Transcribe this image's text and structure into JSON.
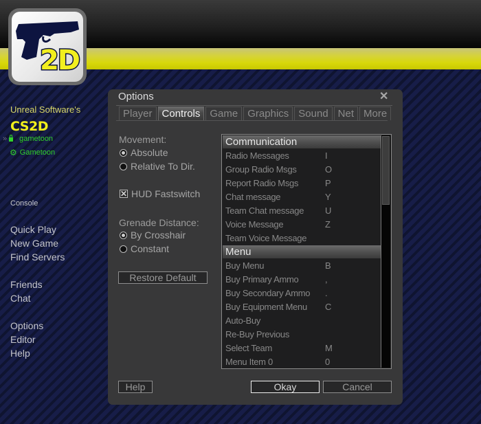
{
  "brand": {
    "logo_text": "2D",
    "publisher": "Unreal Software's",
    "game_title": "CS2D"
  },
  "accounts": [
    {
      "icon": "lock-icon",
      "name": "gametoon"
    },
    {
      "icon": "steam-icon",
      "name": "Gametoon"
    }
  ],
  "sidebar": {
    "console": "Console",
    "groups": [
      [
        "Quick Play",
        "New Game",
        "Find Servers"
      ],
      [
        "Friends",
        "Chat"
      ],
      [
        "Options",
        "Editor",
        "Help"
      ]
    ]
  },
  "dialog": {
    "title": "Options",
    "close_glyph": "✕",
    "tabs": [
      "Player",
      "Controls",
      "Game",
      "Graphics",
      "Sound",
      "Net",
      "More"
    ],
    "active_tab": "Controls",
    "movement": {
      "label": "Movement:",
      "options": [
        "Absolute",
        "Relative To Dir."
      ],
      "selected": "Absolute"
    },
    "hud_fastswitch": {
      "label": "HUD Fastswitch",
      "checked": true,
      "glyph": "✕"
    },
    "grenade_distance": {
      "label": "Grenade Distance:",
      "options": [
        "By Crosshair",
        "Constant"
      ],
      "selected": "By Crosshair"
    },
    "restore_default": "Restore Default",
    "bindings": [
      {
        "category": "Communication",
        "rows": [
          {
            "action": "Radio Messages",
            "key": "I"
          },
          {
            "action": "Group Radio Msgs",
            "key": "O"
          },
          {
            "action": "Report Radio Msgs",
            "key": "P"
          },
          {
            "action": "Chat message",
            "key": "Y"
          },
          {
            "action": "Team Chat message",
            "key": "U"
          },
          {
            "action": "Voice Message",
            "key": "Z"
          },
          {
            "action": "Team Voice Message",
            "key": ""
          }
        ]
      },
      {
        "category": "Menu",
        "rows": [
          {
            "action": "Buy Menu",
            "key": "B"
          },
          {
            "action": "Buy Primary Ammo",
            "key": ","
          },
          {
            "action": "Buy Secondary Ammo",
            "key": "."
          },
          {
            "action": "Buy Equipment Menu",
            "key": "C"
          },
          {
            "action": "Auto-Buy",
            "key": ""
          },
          {
            "action": "Re-Buy Previous",
            "key": ""
          },
          {
            "action": "Select Team",
            "key": "M"
          },
          {
            "action": "Menu Item 0",
            "key": "0"
          }
        ]
      }
    ],
    "scroll_position": 0,
    "buttons": {
      "help": "Help",
      "okay": "Okay",
      "cancel": "Cancel"
    }
  }
}
